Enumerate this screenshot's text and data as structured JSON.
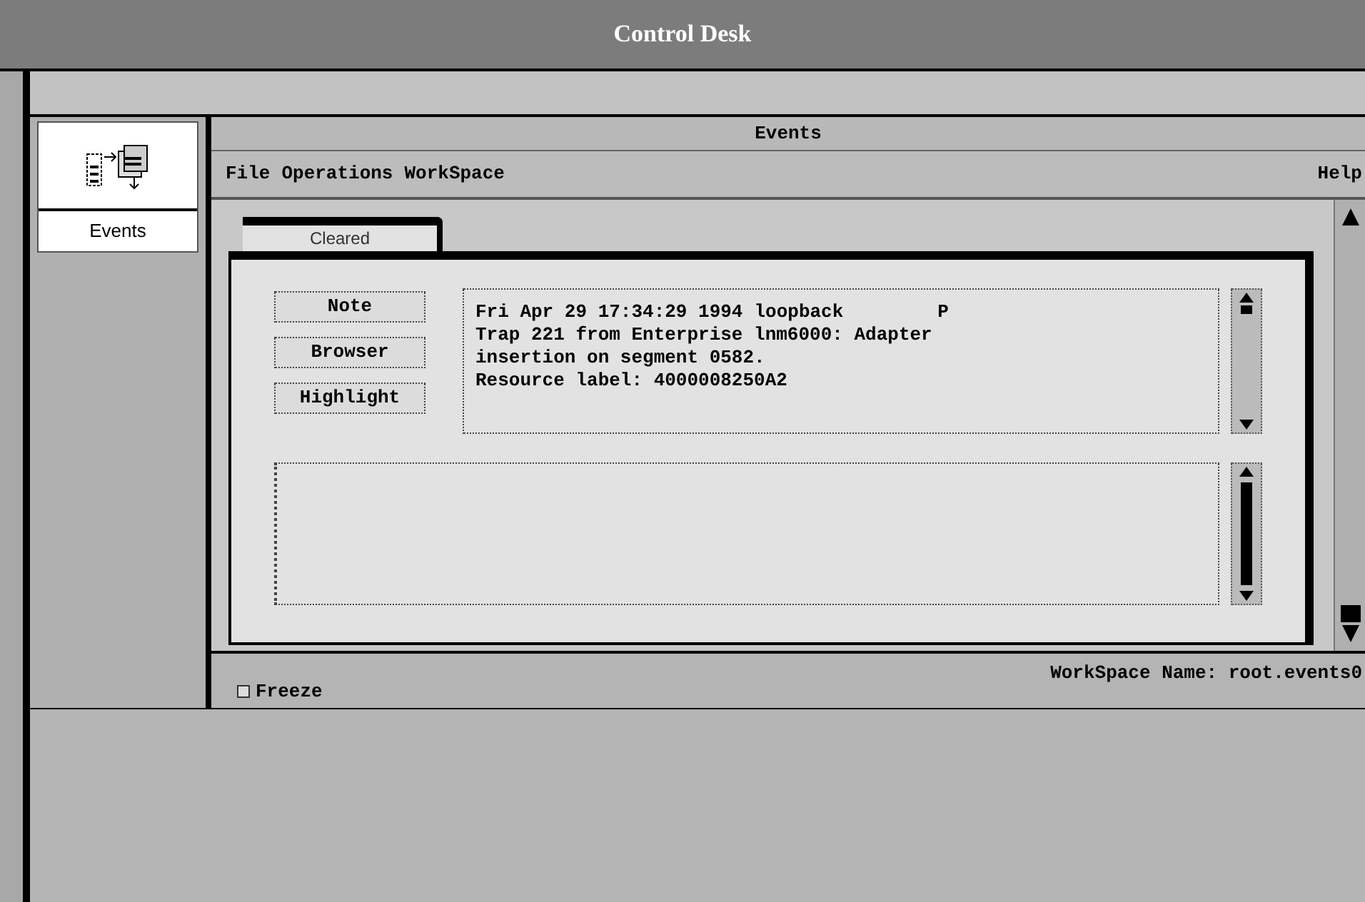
{
  "window": {
    "title": "Control Desk"
  },
  "sidebar": {
    "items": [
      {
        "label": "Events"
      }
    ]
  },
  "events_window": {
    "title": "Events",
    "menu": [
      "File",
      "Operations",
      "WorkSpace"
    ],
    "help_menu": "Help",
    "tabs": [
      {
        "label": "Cleared",
        "selected": true
      }
    ],
    "buttons": [
      "Note",
      "Browser",
      "Highlight"
    ],
    "event": {
      "timestamp": "Fri Apr 29 17:34:29 1994",
      "host": "loopback",
      "flag": "P",
      "lines": [
        "Trap 221 from Enterprise lnm6000: Adapter",
        "insertion on segment 0582.",
        "Resource label: 4000008250A2"
      ]
    },
    "freeze": {
      "label": "Freeze",
      "checked": false
    },
    "workspace_name": "WorkSpace Name: root.events0"
  }
}
